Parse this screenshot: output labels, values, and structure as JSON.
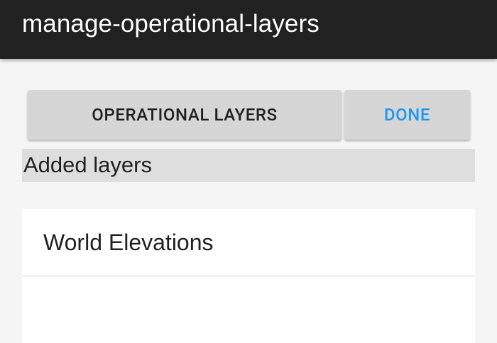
{
  "app_bar": {
    "title": "manage-operational-layers"
  },
  "toolbar": {
    "operational_layers_label": "OPERATIONAL LAYERS",
    "done_label": "DONE"
  },
  "added_layers": {
    "header": "Added layers",
    "items": [
      {
        "label": "World Elevations"
      },
      {
        "label": ""
      }
    ]
  },
  "colors": {
    "app_bar": "#212121",
    "button_background": "#d6d6d6",
    "done_accent": "#2196f3",
    "section_header_background": "#dedede",
    "page_background": "#f5f5f5"
  }
}
